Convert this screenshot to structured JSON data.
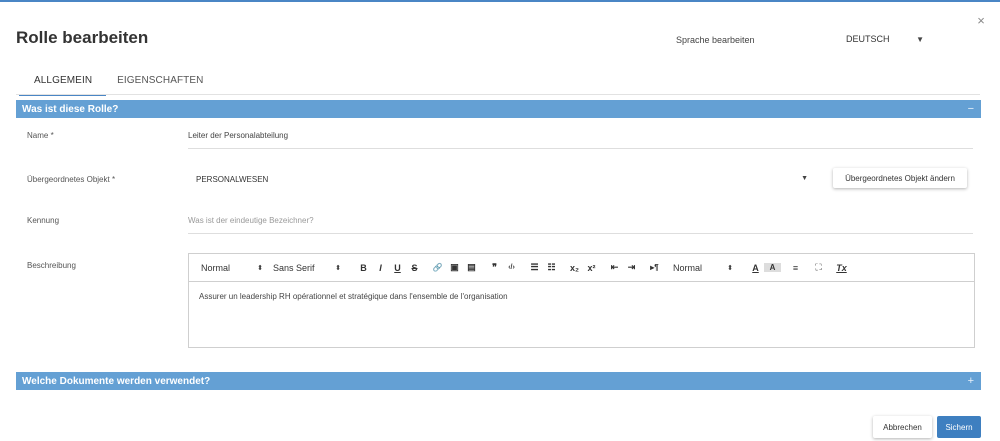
{
  "dialog": {
    "title": "Rolle bearbeiten",
    "close_glyph": "×"
  },
  "language": {
    "label": "Sprache bearbeiten",
    "selected": "DEUTSCH"
  },
  "tabs": [
    {
      "label": "ALLGEMEIN",
      "active": true
    },
    {
      "label": "EIGENSCHAFTEN",
      "active": false
    }
  ],
  "section_general": {
    "title": "Was ist diese Rolle?",
    "toggle": "−"
  },
  "fields": {
    "name": {
      "label": "Name *",
      "value": "Leiter der Personalabteilung"
    },
    "parent": {
      "label": "Übergeordnetes Objekt *",
      "value": "PERSONALWESEN",
      "change_button": "Übergeordnetes Objekt ändern"
    },
    "identifier": {
      "label": "Kennung",
      "placeholder": "Was ist der eindeutige Bezeichner?"
    },
    "description": {
      "label": "Beschreibung",
      "value": "Assurer un leadership RH opérationnel et stratégique dans l'ensemble de l'organisation"
    }
  },
  "editor_toolbar": {
    "heading_select": "Normal",
    "font_select": "Sans Serif",
    "size_select": "Normal",
    "bold": "B",
    "italic": "I",
    "underline": "U",
    "strike": "S",
    "link": "🔗",
    "image": "▣",
    "video": "▤",
    "quote": "❞",
    "code": "‹/›",
    "ordered_list": "☰",
    "bullet_list": "☷",
    "subscript": "x₂",
    "superscript": "x²",
    "outdent": "⇤",
    "indent": "⇥",
    "direction": "▸¶",
    "font_color": "A",
    "background_color": "A",
    "align": "≡",
    "fullscreen": "⛶",
    "clean": "Tx"
  },
  "section_documents": {
    "title": "Welche Dokumente werden verwendet?",
    "toggle": "+"
  },
  "footer": {
    "cancel": "Abbrechen",
    "save": "Sichern"
  },
  "colors": {
    "accent": "#4a86c5",
    "section_bar": "#64a0d4",
    "primary_button": "#3e7fc0"
  }
}
